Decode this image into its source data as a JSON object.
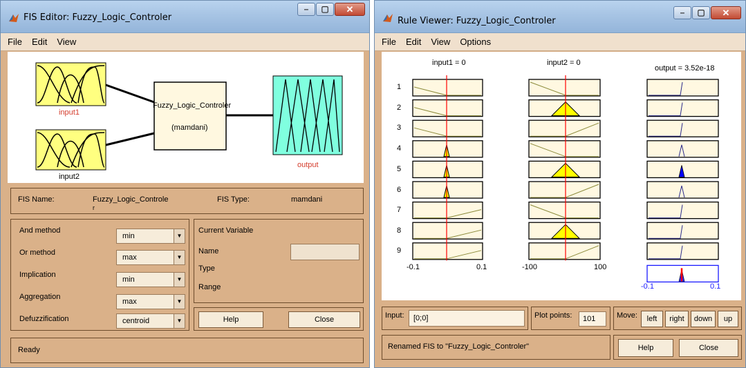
{
  "fis_editor": {
    "title": "FIS Editor: Fuzzy_Logic_Controler",
    "menu": [
      "File",
      "Edit",
      "View"
    ],
    "diagram": {
      "input1": "input1",
      "input2": "input2",
      "system_name": "Fuzzy_Logic_Controler",
      "system_type": "(mamdani)",
      "output": "output"
    },
    "fis_name_label": "FIS Name:",
    "fis_name_value": "Fuzzy_Logic_Controle",
    "fis_name_wrap": "r",
    "fis_type_label": "FIS Type:",
    "fis_type_value": "mamdani",
    "methods": {
      "and_label": "And method",
      "and_value": "min",
      "or_label": "Or method",
      "or_value": "max",
      "implication_label": "Implication",
      "implication_value": "min",
      "aggregation_label": "Aggregation",
      "aggregation_value": "max",
      "defuzz_label": "Defuzzification",
      "defuzz_value": "centroid"
    },
    "current_variable": {
      "heading": "Current Variable",
      "name_label": "Name",
      "type_label": "Type",
      "range_label": "Range",
      "name_value": ""
    },
    "help_label": "Help",
    "close_label": "Close",
    "status": "Ready"
  },
  "rule_viewer": {
    "title": "Rule Viewer: Fuzzy_Logic_Controler",
    "menu": [
      "File",
      "Edit",
      "View",
      "Options"
    ],
    "col_headers": {
      "input1": "input1 = 0",
      "input2": "input2 = 0",
      "output": "output = 3.52e-18"
    },
    "rows": [
      "1",
      "2",
      "3",
      "4",
      "5",
      "6",
      "7",
      "8",
      "9"
    ],
    "axis": {
      "input1_min": "-0.1",
      "input1_max": "0.1",
      "input2_min": "-100",
      "input2_max": "100",
      "output_min": "-0.1",
      "output_max": "0.1"
    },
    "input_label": "Input:",
    "input_value": "[0;0]",
    "plot_points_label": "Plot points:",
    "plot_points_value": "101",
    "move_label": "Move:",
    "move_buttons": [
      "left",
      "right",
      "down",
      "up"
    ],
    "status": "Renamed FIS to \"Fuzzy_Logic_Controler\"",
    "help_label": "Help",
    "close_label": "Close"
  },
  "colors": {
    "panel_bg": "#dab189",
    "mf_box_fill": "#ffff80",
    "output_box_fill": "#80ffdf",
    "plot_bg": "#fff8e1",
    "center_line": "#ff0000",
    "input_fire_fill": "#ffff00",
    "output_fire_fill": "#0000ff"
  }
}
